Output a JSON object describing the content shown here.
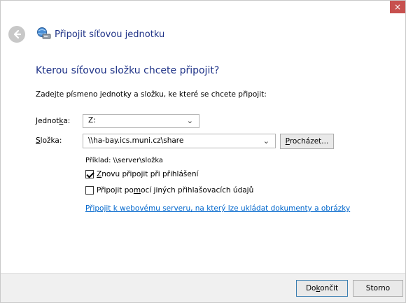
{
  "window": {
    "close_glyph": "×"
  },
  "titlebar": {
    "title": "Připojit síťovou jednotku"
  },
  "main": {
    "heading": "Kterou síťovou složku chcete připojit?",
    "instruction": "Zadejte písmeno jednotky a složku, ke které se chcete připojit:",
    "drive": {
      "label_pre": "Jednot",
      "label_accel": "k",
      "label_post": "a:",
      "value": "Z:"
    },
    "folder": {
      "label_accel": "S",
      "label_post": "ložka:",
      "value": "\\\\ha-bay.ics.muni.cz\\share"
    },
    "browse": {
      "accel": "P",
      "rest": "rocházet..."
    },
    "example": "Příklad: \\\\server\\složka",
    "reconnect": {
      "checked": true,
      "accel": "Z",
      "rest": "novu připojit při přihlášení"
    },
    "other_credentials": {
      "checked": false,
      "pre": "Připojit po",
      "accel": "m",
      "rest": "ocí jiných přihlašovacích údajů"
    },
    "web_link": "Připojit k webovému serveru, na který lze ukládat dokumenty a obrázky"
  },
  "footer": {
    "finish": {
      "pre": "Do",
      "accel": "k",
      "post": "ončit"
    },
    "cancel": "Storno"
  },
  "colors": {
    "title_blue": "#1e3287",
    "link_blue": "#0066cc",
    "close_red": "#c7504e"
  }
}
